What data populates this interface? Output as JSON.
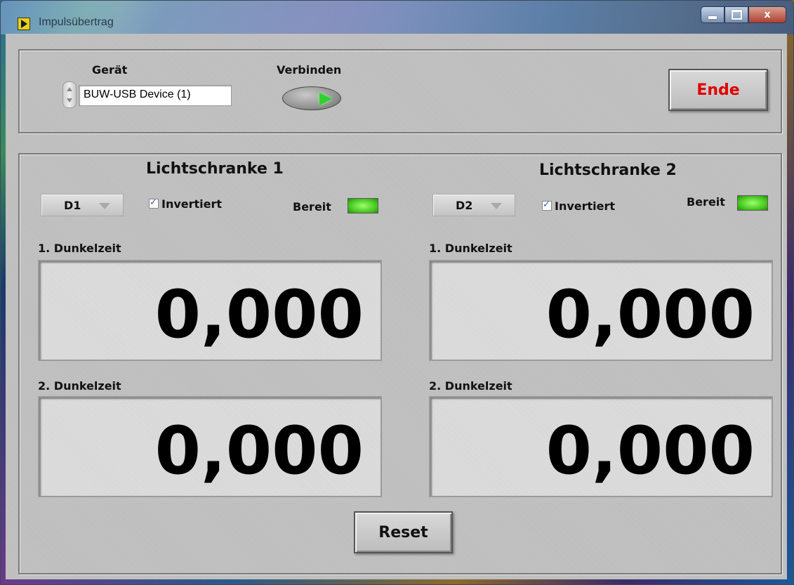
{
  "window": {
    "title": "Impulsübertrag",
    "controls": {
      "minimize": "minimize",
      "maximize": "maximize",
      "close": "x"
    }
  },
  "top": {
    "device_label": "Gerät",
    "device_value": "BUW-USB Device (1)",
    "connect_label": "Verbinden",
    "end_button": "Ende"
  },
  "sensor1": {
    "title": "Lichtschranke 1",
    "channel": "D1",
    "inverted_label": "Invertiert",
    "inverted_checked": true,
    "ready_label": "Bereit",
    "dark1_label": "1. Dunkelzeit",
    "dark1_value": "0,000",
    "dark2_label": "2. Dunkelzeit",
    "dark2_value": "0,000"
  },
  "sensor2": {
    "title": "Lichtschranke 2",
    "channel": "D2",
    "inverted_label": "Invertiert",
    "inverted_checked": true,
    "ready_label": "Bereit",
    "dark1_label": "1. Dunkelzeit",
    "dark1_value": "0,000",
    "dark2_label": "2. Dunkelzeit",
    "dark2_value": "0,000"
  },
  "reset_button": "Reset",
  "colors": {
    "end_text": "#e00000",
    "led_on": "#3fc21a",
    "panel_bg": "#bdbdbd"
  }
}
